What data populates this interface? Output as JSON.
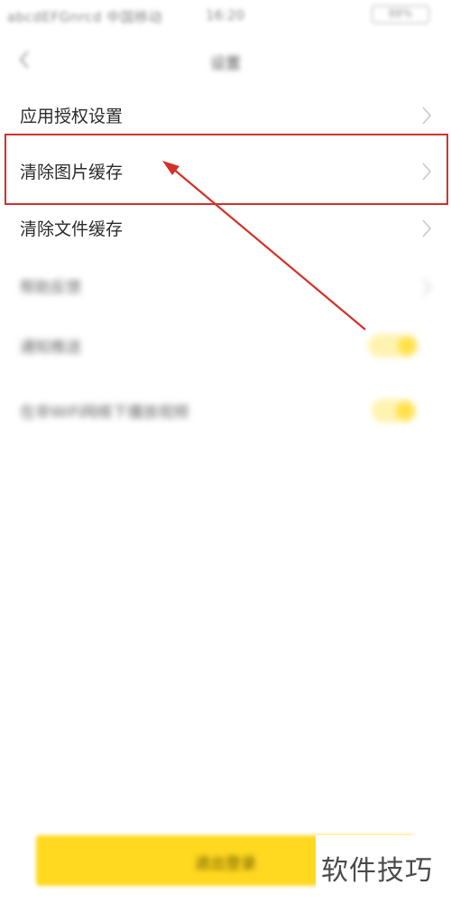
{
  "status_bar": {
    "carrier": "abcdEFGnrcd 中国移动",
    "time": "16:20",
    "battery": "88%"
  },
  "header": {
    "title": "设置",
    "back_icon": "chevron-left-icon"
  },
  "settings": {
    "items": [
      {
        "label": "应用授权设置",
        "control": "chevron"
      },
      {
        "label": "清除图片缓存",
        "control": "chevron"
      },
      {
        "label": "清除文件缓存",
        "control": "chevron"
      },
      {
        "label": "帮助反馈",
        "control": "chevron"
      },
      {
        "label": "通知推送",
        "control": "toggle",
        "on": true
      },
      {
        "label": "在非WiFi网络下播放视频",
        "control": "toggle",
        "on": true
      }
    ]
  },
  "annotation": {
    "highlight_color": "#d2312a",
    "arrow_color": "#d2312a"
  },
  "footer": {
    "logout_label": "退出登录",
    "accent_color": "#ffd820"
  },
  "watermark": {
    "text": "软件技巧"
  }
}
